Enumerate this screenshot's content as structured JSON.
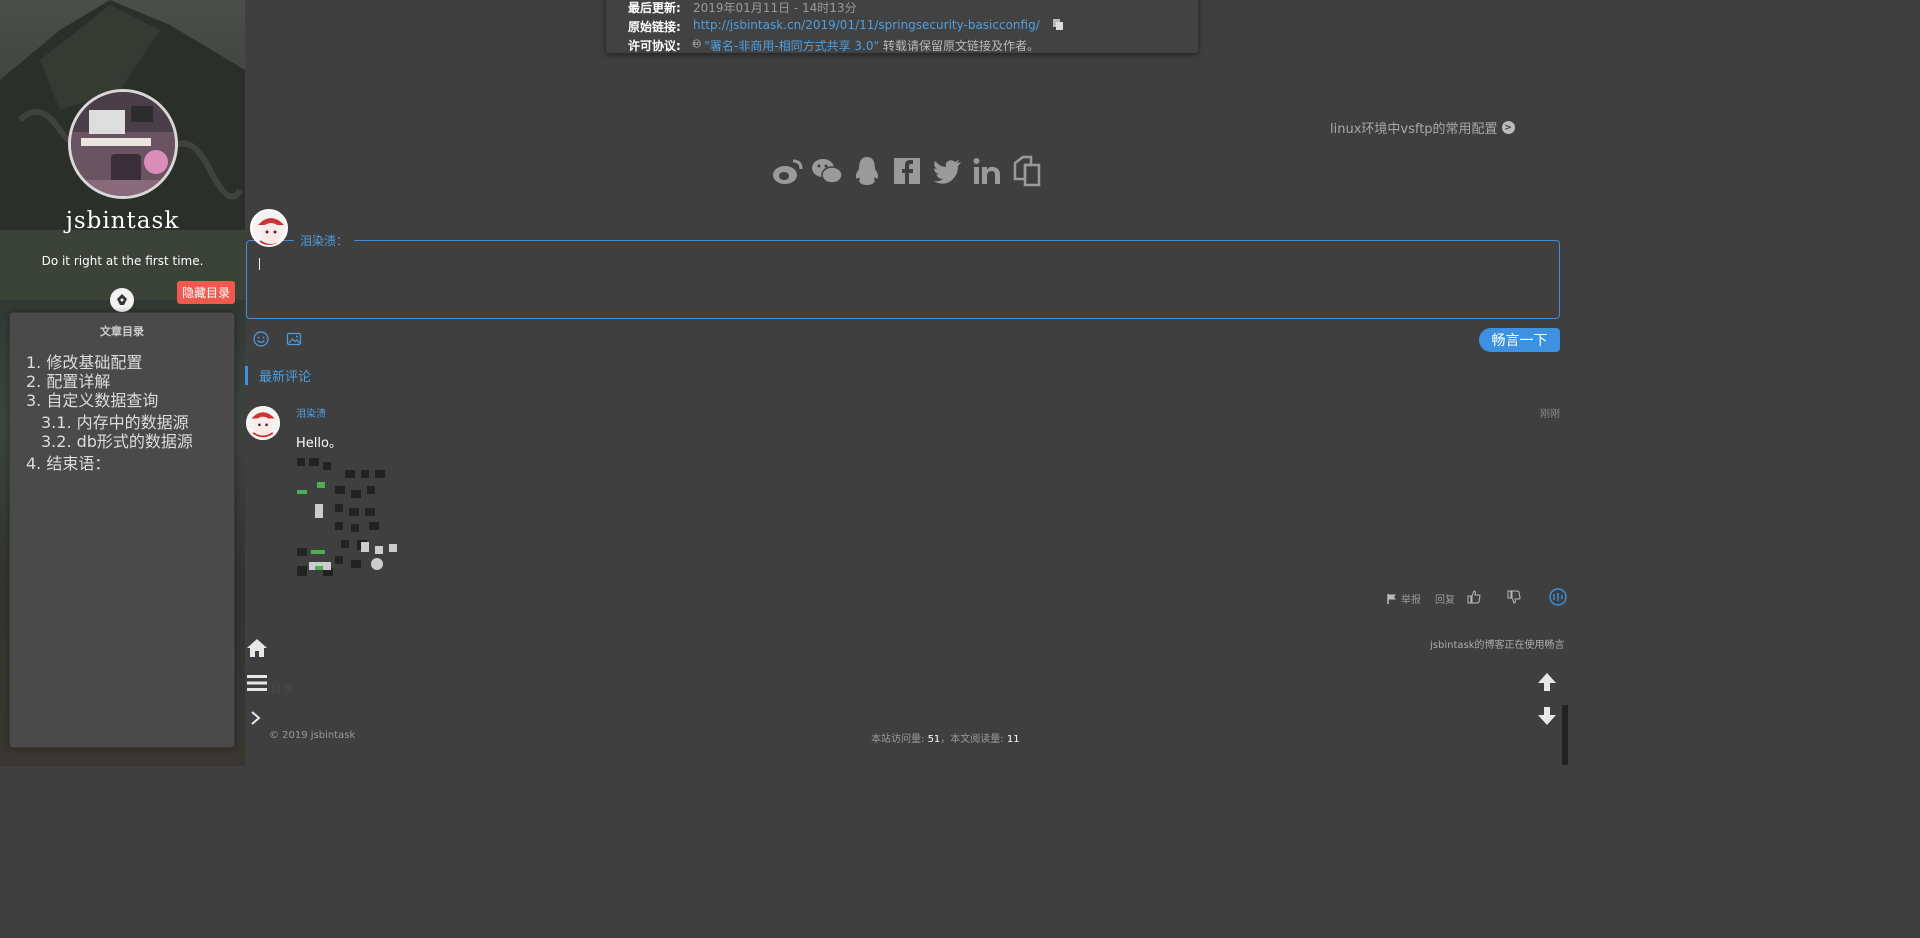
{
  "sidebar": {
    "blog_title": "jsbintask",
    "motto": "Do it right at the first time.",
    "hide_toc_label": "隐藏目录",
    "toc": {
      "title": "文章目录",
      "items": [
        "1. 修改基础配置",
        "2. 配置详解",
        "3. 自定义数据查询",
        "3.1. 内存中的数据源",
        "3.2. db形式的数据源",
        "4. 结束语："
      ]
    }
  },
  "post_info": {
    "updated_label": "最后更新:",
    "updated_value": "2019年01月11日 - 14时13分",
    "link_label": "原始链接:",
    "link_value": "http://jsbintask.cn/2019/01/11/springsecurity-basicconfig/",
    "license_label": "许可协议:",
    "license_link": "\"署名-非商用-相同方式共享 3.0\"",
    "license_note": "转载请保留原文链接及作者。"
  },
  "next_post": "linux环境中vsftp的常用配置",
  "share_icons": [
    "weibo-icon",
    "wechat-icon",
    "qq-icon",
    "facebook-icon",
    "twitter-icon",
    "linkedin-icon",
    "copy-icon"
  ],
  "comment_form": {
    "nickname": "泪染渍：",
    "submit_label": "畅言一下"
  },
  "latest_comments": {
    "title": "最新评论",
    "items": [
      {
        "author": "泪染渍",
        "time": "刚刚",
        "text": "Hello。"
      }
    ]
  },
  "comment_actions": {
    "report": "举报",
    "reply": "回复"
  },
  "powered_by": "jsbintask的博客正在使用畅言",
  "ghost_label": "目录",
  "footer": {
    "copyright": "© 2019 jsbintask",
    "stats_prefix": "本站访问量: ",
    "site_visits": "51",
    "stats_middle": "，本文阅读量: ",
    "post_reads": "11"
  },
  "colors": {
    "accent": "#3c92e0",
    "hide_button": "#ef5a4f",
    "background": "#3f3f3f"
  }
}
